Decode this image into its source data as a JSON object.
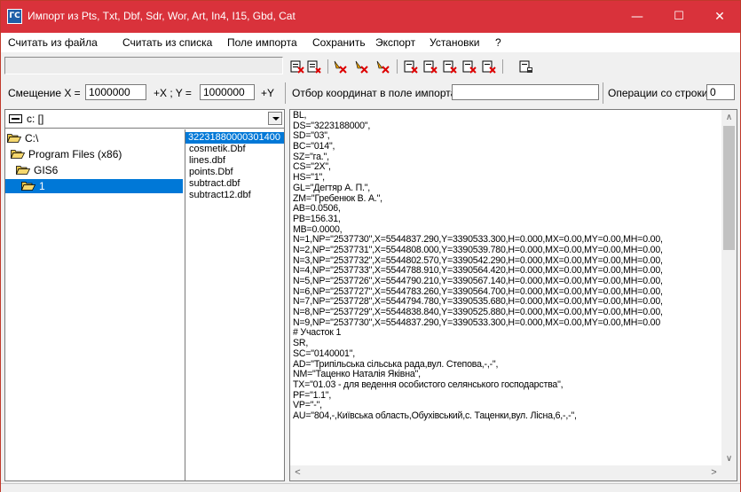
{
  "window": {
    "title": "Импорт из Pts, Txt, Dbf, Sdr, Wor, Art, In4, I15, Gbd, Cat",
    "icon_label": "ГС",
    "minimize_glyph": "—",
    "maximize_glyph": "☐",
    "close_glyph": "✕"
  },
  "menu": [
    "Считать из файла",
    "Считать из списка",
    "Поле импорта",
    "Сохранить",
    "Экспорт",
    "Установки",
    "?"
  ],
  "toolbar": {
    "icons": [
      "import-file-icon",
      "import-list-icon",
      "select-point-icon",
      "select-point-add-icon",
      "select-point-remove-icon",
      "export-icon-1",
      "export-icon-2",
      "export-icon-3",
      "export-icon-4",
      "export-icon-5",
      "save-icon"
    ]
  },
  "coords": {
    "offset_label": "Смещение X =",
    "x_value": "1000000",
    "x_suffix": "+X ; Y =",
    "y_value": "1000000",
    "y_suffix": "+Y",
    "select_label": "Отбор координат в поле импорта",
    "select_value": "",
    "ops_label": "Операции со строки",
    "ops_value": "0"
  },
  "drive": {
    "value": "c: []"
  },
  "dirs": [
    {
      "name": "C:\\",
      "level": 0,
      "open": true
    },
    {
      "name": "Program Files (x86)",
      "level": 1,
      "open": true
    },
    {
      "name": "GIS6",
      "level": 2,
      "open": true
    },
    {
      "name": "1",
      "level": 3,
      "open": true,
      "selected": true
    }
  ],
  "files": [
    {
      "name": "32231880000301400",
      "selected": true
    },
    {
      "name": "cosmetik.Dbf"
    },
    {
      "name": "lines.dbf"
    },
    {
      "name": "points.Dbf"
    },
    {
      "name": "subtract.dbf"
    },
    {
      "name": "subtract12.dbf"
    }
  ],
  "text_lines": [
    "BL,",
    "DS=\"3223188000\",",
    "SD=\"03\",",
    "BC=\"014\",",
    "SZ=\"га.\",",
    "CS=\"2X\",",
    "HS=\"1\",",
    "GL=\"Дегтяр А. П.\",",
    "ZM=\"Гребенюк В. А.\",",
    "AB=0.0506,",
    "PB=156.31,",
    "MB=0.0000,",
    "N=1,NP=\"2537730\",X=5544837.290,Y=3390533.300,H=0.000,MX=0.00,MY=0.00,MH=0.00,",
    "N=2,NP=\"2537731\",X=5544808.000,Y=3390539.780,H=0.000,MX=0.00,MY=0.00,MH=0.00,",
    "N=3,NP=\"2537732\",X=5544802.570,Y=3390542.290,H=0.000,MX=0.00,MY=0.00,MH=0.00,",
    "N=4,NP=\"2537733\",X=5544788.910,Y=3390564.420,H=0.000,MX=0.00,MY=0.00,MH=0.00,",
    "N=5,NP=\"2537726\",X=5544790.210,Y=3390567.140,H=0.000,MX=0.00,MY=0.00,MH=0.00,",
    "N=6,NP=\"2537727\",X=5544783.260,Y=3390564.700,H=0.000,MX=0.00,MY=0.00,MH=0.00,",
    "N=7,NP=\"2537728\",X=5544794.780,Y=3390535.680,H=0.000,MX=0.00,MY=0.00,MH=0.00,",
    "N=8,NP=\"2537729\",X=5544838.840,Y=3390525.880,H=0.000,MX=0.00,MY=0.00,MH=0.00,",
    "N=9,NP=\"2537730\",X=5544837.290,Y=3390533.300,H=0.000,MX=0.00,MY=0.00,MH=0.00",
    "# Участок 1",
    "SR,",
    "SC=\"0140001\",",
    "AD=\"Трипільська сільська рада,вул. Степова,-,-\",",
    "NM=\"Таценко Наталія Яківна\",",
    "TX=\"01.03 - для ведення особистого селянського господарства\",",
    "PF=\"1.1\",",
    "VP=\"-\",",
    "AU=\"804,-,Київська область,Обухівський,с. Таценки,вул. Лісна,6,-,-\","
  ],
  "scroll": {
    "up": "∧",
    "down": "∨",
    "left": "<",
    "right": ">"
  },
  "colors": {
    "title_bar": "#d9323b",
    "selection": "#0078d7",
    "folder": "#e8c547"
  }
}
